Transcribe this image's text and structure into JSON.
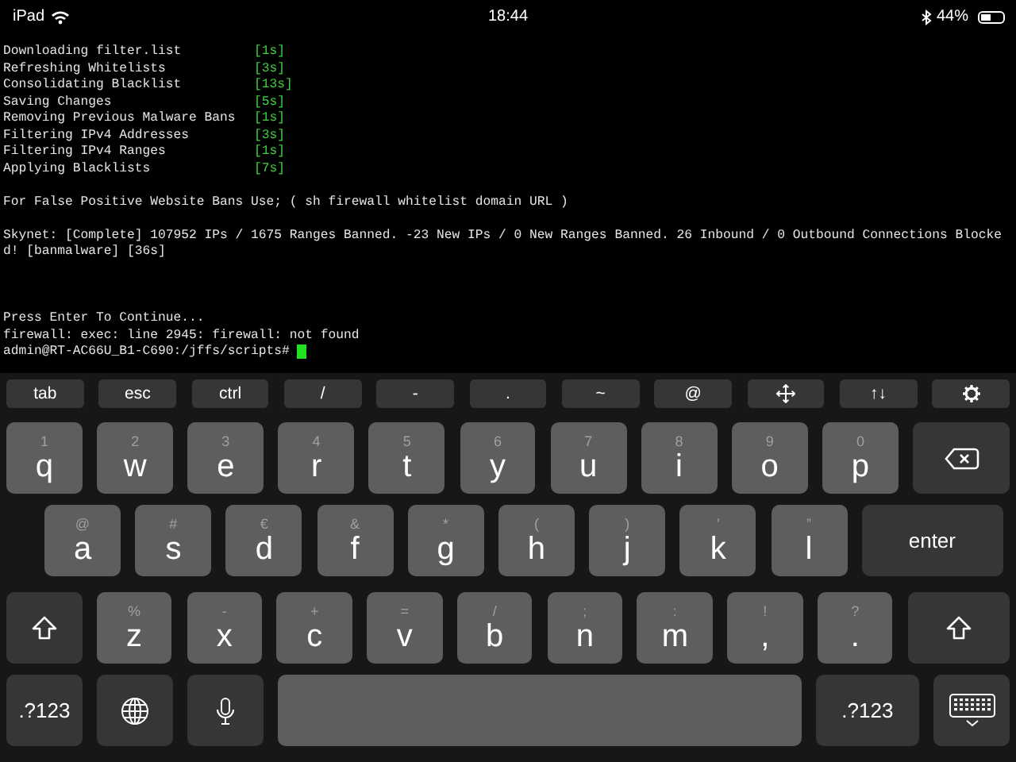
{
  "status_bar": {
    "device": "iPad",
    "time": "18:44",
    "battery_percent": "44%",
    "battery": {
      "level": 0.44
    }
  },
  "terminal": {
    "lines": [
      {
        "kind": "step",
        "label": "Downloading filter.list",
        "time": "[1s]"
      },
      {
        "kind": "step",
        "label": "Refreshing Whitelists",
        "time": "[3s]"
      },
      {
        "kind": "step",
        "label": "Consolidating Blacklist",
        "time": "[13s]"
      },
      {
        "kind": "step",
        "label": "Saving Changes",
        "time": "[5s]"
      },
      {
        "kind": "step",
        "label": "Removing Previous Malware Bans",
        "time": "[1s]"
      },
      {
        "kind": "step",
        "label": "Filtering IPv4 Addresses",
        "time": "[3s]"
      },
      {
        "kind": "step",
        "label": "Filtering IPv4 Ranges",
        "time": "[1s]"
      },
      {
        "kind": "step",
        "label": "Applying Blacklists",
        "time": "[7s]"
      },
      {
        "kind": "blank"
      },
      {
        "kind": "text",
        "text": "For False Positive Website Bans Use; ( sh firewall whitelist domain URL )"
      },
      {
        "kind": "blank"
      },
      {
        "kind": "text",
        "text": "Skynet: [Complete] 107952 IPs / 1675 Ranges Banned. -23 New IPs / 0 New Ranges Banned. 26 Inbound / 0 Outbound Connections Blocked! [banmalware] [36s]"
      },
      {
        "kind": "blank"
      },
      {
        "kind": "blank"
      },
      {
        "kind": "blank"
      },
      {
        "kind": "text",
        "text": "Press Enter To Continue..."
      },
      {
        "kind": "text",
        "text": "firewall: exec: line 2945: firewall: not found"
      },
      {
        "kind": "prompt",
        "text": "admin@RT-AC66U_B1-C690:/jffs/scripts#"
      }
    ]
  },
  "keyboard": {
    "accessory_keys": [
      {
        "kind": "text",
        "label": "tab"
      },
      {
        "kind": "text",
        "label": "esc"
      },
      {
        "kind": "text",
        "label": "ctrl"
      },
      {
        "kind": "text",
        "label": "/"
      },
      {
        "kind": "text",
        "label": "-"
      },
      {
        "kind": "text",
        "label": "."
      },
      {
        "kind": "text",
        "label": "~"
      },
      {
        "kind": "text",
        "label": "@"
      },
      {
        "kind": "move"
      },
      {
        "kind": "text",
        "label": "↑↓"
      },
      {
        "kind": "settings"
      }
    ],
    "rows": [
      {
        "keys": [
          {
            "kind": "letter",
            "hint": "1",
            "label": "q"
          },
          {
            "kind": "letter",
            "hint": "2",
            "label": "w"
          },
          {
            "kind": "letter",
            "hint": "3",
            "label": "e"
          },
          {
            "kind": "letter",
            "hint": "4",
            "label": "r"
          },
          {
            "kind": "letter",
            "hint": "5",
            "label": "t"
          },
          {
            "kind": "letter",
            "hint": "6",
            "label": "y"
          },
          {
            "kind": "letter",
            "hint": "7",
            "label": "u"
          },
          {
            "kind": "letter",
            "hint": "8",
            "label": "i"
          },
          {
            "kind": "letter",
            "hint": "9",
            "label": "o"
          },
          {
            "kind": "letter",
            "hint": "0",
            "label": "p"
          },
          {
            "kind": "backspace"
          }
        ]
      },
      {
        "keys": [
          {
            "kind": "letter",
            "hint": "@",
            "label": "a"
          },
          {
            "kind": "letter",
            "hint": "#",
            "label": "s"
          },
          {
            "kind": "letter",
            "hint": "€",
            "label": "d"
          },
          {
            "kind": "letter",
            "hint": "&",
            "label": "f"
          },
          {
            "kind": "letter",
            "hint": "*",
            "label": "g"
          },
          {
            "kind": "letter",
            "hint": "(",
            "label": "h"
          },
          {
            "kind": "letter",
            "hint": ")",
            "label": "j"
          },
          {
            "kind": "letter",
            "hint": "’",
            "label": "k"
          },
          {
            "kind": "letter",
            "hint": "”",
            "label": "l"
          },
          {
            "kind": "action",
            "label": "enter"
          }
        ]
      },
      {
        "keys": [
          {
            "kind": "shift"
          },
          {
            "kind": "letter",
            "hint": "%",
            "label": "z"
          },
          {
            "kind": "letter",
            "hint": "-",
            "label": "x"
          },
          {
            "kind": "letter",
            "hint": "+",
            "label": "c"
          },
          {
            "kind": "letter",
            "hint": "=",
            "label": "v"
          },
          {
            "kind": "letter",
            "hint": "/",
            "label": "b"
          },
          {
            "kind": "letter",
            "hint": ";",
            "label": "n"
          },
          {
            "kind": "letter",
            "hint": ":",
            "label": "m"
          },
          {
            "kind": "letter",
            "hint": "!",
            "label": ","
          },
          {
            "kind": "letter",
            "hint": "?",
            "label": "."
          },
          {
            "kind": "shift"
          }
        ]
      },
      {
        "keys": [
          {
            "kind": "action",
            "label": ".?123"
          },
          {
            "kind": "globe"
          },
          {
            "kind": "mic"
          },
          {
            "kind": "space"
          },
          {
            "kind": "action",
            "label": ".?123"
          },
          {
            "kind": "hide"
          }
        ]
      }
    ]
  }
}
